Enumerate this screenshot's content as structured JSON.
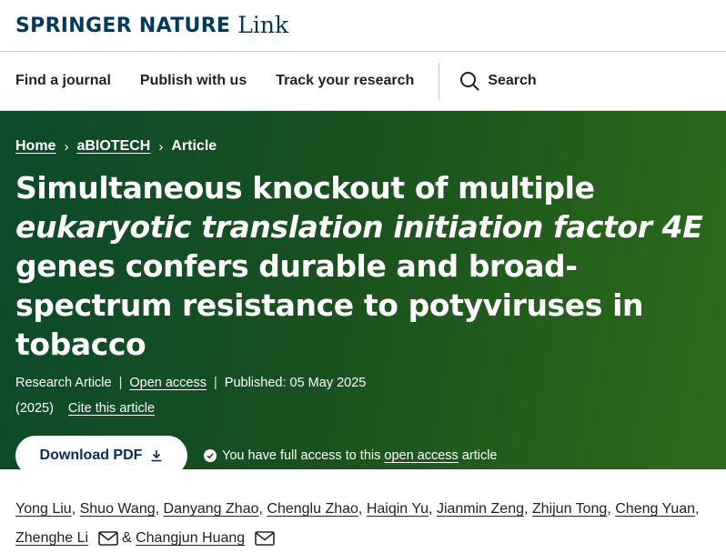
{
  "brand": {
    "name": "SPRINGER NATURE",
    "suffix": "Link",
    "color": "#03395b"
  },
  "nav": {
    "items": [
      "Find a journal",
      "Publish with us",
      "Track your research"
    ],
    "search_label": "Search",
    "search_icon": "search-icon"
  },
  "hero": {
    "background": "#19501f",
    "breadcrumbs": [
      "Home",
      "aBIOTECH",
      "Article"
    ],
    "title": {
      "part1": "Simultaneous knockout of multiple",
      "italic": "eukaryotic translation initiation factor 4E",
      "part2": "genes confers durable and broad-spectrum resistance to potyviruses in tobacco"
    },
    "meta": {
      "type": "Research Article",
      "access": "Open access",
      "published": "Published: 05 May 2025",
      "year": "(2025)",
      "cite": "Cite this article"
    },
    "download_label": "Download PDF",
    "access_notice": {
      "prefix": "You have full access to this",
      "link": "open access",
      "suffix": "article"
    }
  },
  "authors": {
    "names": [
      "Yong Liu",
      "Shuo Wang",
      "Danyang Zhao",
      "Chenglu Zhao",
      "Haiqin Yu",
      "Jianmin Zeng",
      "Zhijun Tong",
      "Cheng Yuan",
      "Zhenghe Li",
      "Changjun Huang"
    ],
    "separator": ",",
    "and": "&"
  }
}
